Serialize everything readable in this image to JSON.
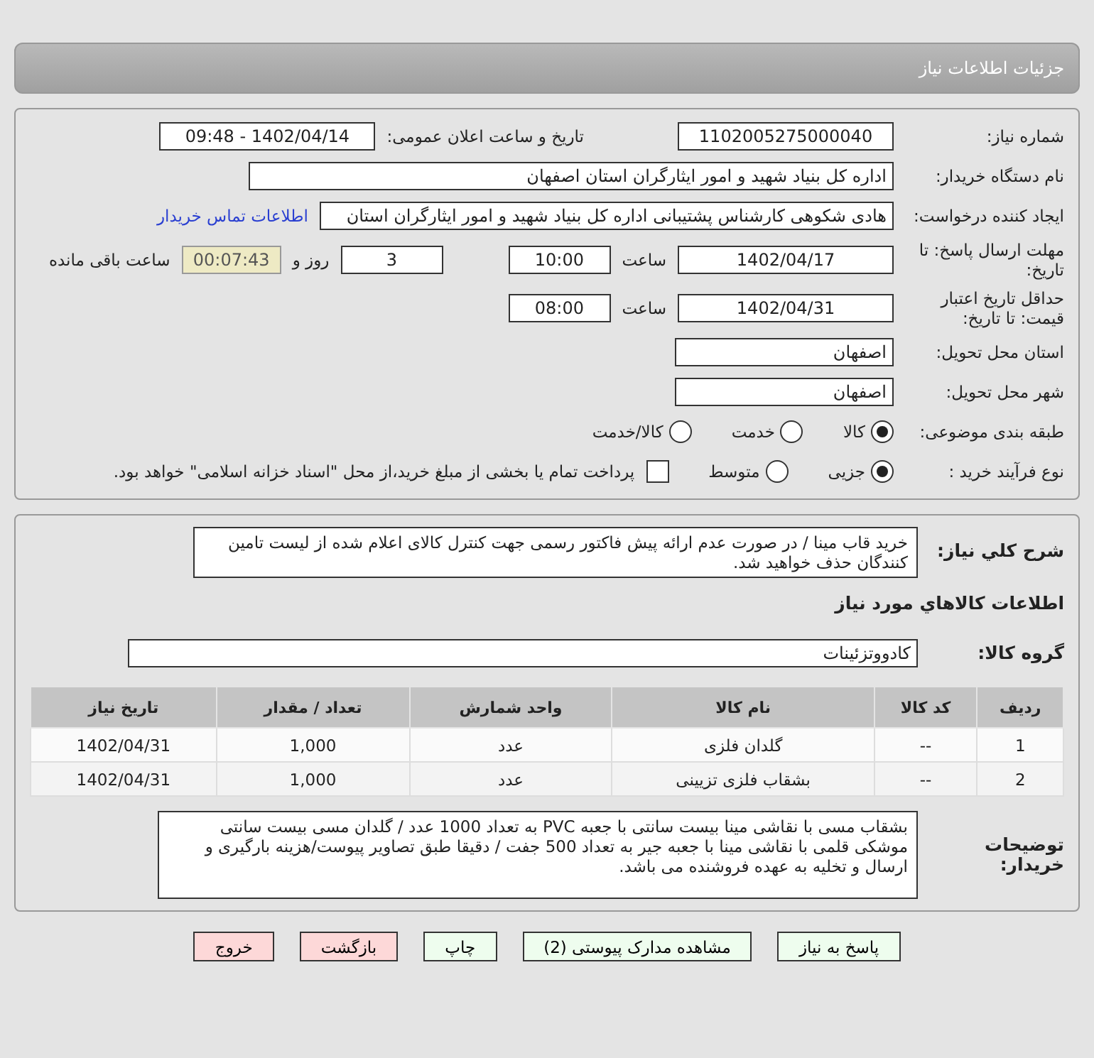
{
  "page_title": "جزئیات اطلاعات نیاز",
  "need_number": {
    "label": "شماره نیاز:",
    "value": "1102005275000040"
  },
  "announce": {
    "label": "تاریخ و ساعت اعلان عمومی:",
    "value": "1402/04/14 - 09:48"
  },
  "buyer_org": {
    "label": "نام دستگاه خریدار:",
    "value": "اداره کل بنیاد شهید و امور ایثارگران استان اصفهان"
  },
  "requester": {
    "label": "ایجاد کننده درخواست:",
    "value": "هادی شکوهی کارشناس پشتیبانی اداره کل بنیاد شهید و امور ایثارگران استان",
    "link": "اطلاعات تماس خریدار"
  },
  "deadline": {
    "label": "مهلت ارسال پاسخ: تا تاریخ:",
    "date": "1402/04/17",
    "time_label": "ساعت",
    "time": "10:00",
    "days": "3",
    "days_label": "روز و",
    "remaining": "00:07:43",
    "remaining_label": "ساعت باقی مانده"
  },
  "validity": {
    "label": "حداقل تاریخ اعتبار قیمت: تا تاریخ:",
    "date": "1402/04/31",
    "time_label": "ساعت",
    "time": "08:00"
  },
  "province": {
    "label": "استان محل تحویل:",
    "value": "اصفهان"
  },
  "city": {
    "label": "شهر محل تحویل:",
    "value": "اصفهان"
  },
  "category": {
    "label": "طبقه بندی موضوعی:",
    "options": [
      {
        "label": "کالا",
        "selected": true
      },
      {
        "label": "خدمت",
        "selected": false
      },
      {
        "label": "کالا/خدمت",
        "selected": false
      }
    ]
  },
  "process": {
    "label": "نوع فرآیند خرید :",
    "options": [
      {
        "label": "جزیی",
        "selected": true
      },
      {
        "label": "متوسط",
        "selected": false
      }
    ],
    "payment": {
      "checked": false,
      "text": "پرداخت تمام یا بخشی از مبلغ خرید،از محل \"اسناد خزانه اسلامی\" خواهد بود."
    }
  },
  "summary": {
    "label": "شرح کلي نياز:",
    "text": "خرید قاب مینا / در صورت عدم ارائه پیش فاکتور رسمی جهت کنترل کالای اعلام شده از لیست تامین کنندگان حذف خواهید شد."
  },
  "goods_title": "اطلاعات کالاهاي مورد نياز",
  "group": {
    "label": "گروه کالا:",
    "value": "کادووتزئینات"
  },
  "table": {
    "columns": [
      "ردیف",
      "کد کالا",
      "نام کالا",
      "واحد شمارش",
      "تعداد / مقدار",
      "تاریخ نیاز"
    ],
    "rows": [
      [
        "1",
        "--",
        "گلدان فلزی",
        "عدد",
        "1,000",
        "1402/04/31"
      ],
      [
        "2",
        "--",
        "بشقاب فلزی تزیینی",
        "عدد",
        "1,000",
        "1402/04/31"
      ]
    ]
  },
  "notes": {
    "label": "توضیحات خریدار:",
    "text": "بشقاب مسی با نقاشی مینا بیست سانتی با جعبه PVC  به تعداد 1000 عدد / گلدان مسی بیست سانتی موشکی قلمی با نقاشی مینا با جعبه جیر به تعداد 500 جفت / دقیقا طبق تصاویر پیوست/هزینه بارگیری و ارسال و تخلیه به عهده فروشنده می باشد."
  },
  "buttons": [
    {
      "label": "پاسخ به نیاز",
      "kind": "normal"
    },
    {
      "label": "مشاهده مدارک پیوستی (2)",
      "kind": "normal"
    },
    {
      "label": "چاپ",
      "kind": "normal"
    },
    {
      "label": "بازگشت",
      "kind": "warn"
    },
    {
      "label": "خروج",
      "kind": "warn"
    }
  ]
}
